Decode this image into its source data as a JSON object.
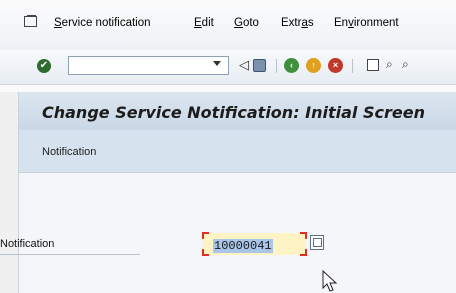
{
  "menubar": {
    "items": [
      {
        "label": "Service notification",
        "mnemonic": "S"
      },
      {
        "label": "Edit",
        "mnemonic": "E"
      },
      {
        "label": "Goto",
        "mnemonic": "G"
      },
      {
        "label": "Extras",
        "mnemonic": "a"
      },
      {
        "label": "Environment",
        "mnemonic": "v"
      }
    ]
  },
  "toolbar": {
    "command_field": "",
    "icons": [
      "enter-icon",
      "back-icon",
      "save-icon",
      "exit-icon",
      "cancel-icon",
      "print-icon",
      "find-icon"
    ]
  },
  "screen": {
    "title": "Change Service Notification: Initial Screen",
    "subbar_button": "Notification"
  },
  "form": {
    "notification_label": "Notification",
    "notification_value": "10000041"
  },
  "colors": {
    "title_bg": "#c9d7e6",
    "input_bg": "#fdf3c5",
    "required_marker": "#e03020"
  }
}
